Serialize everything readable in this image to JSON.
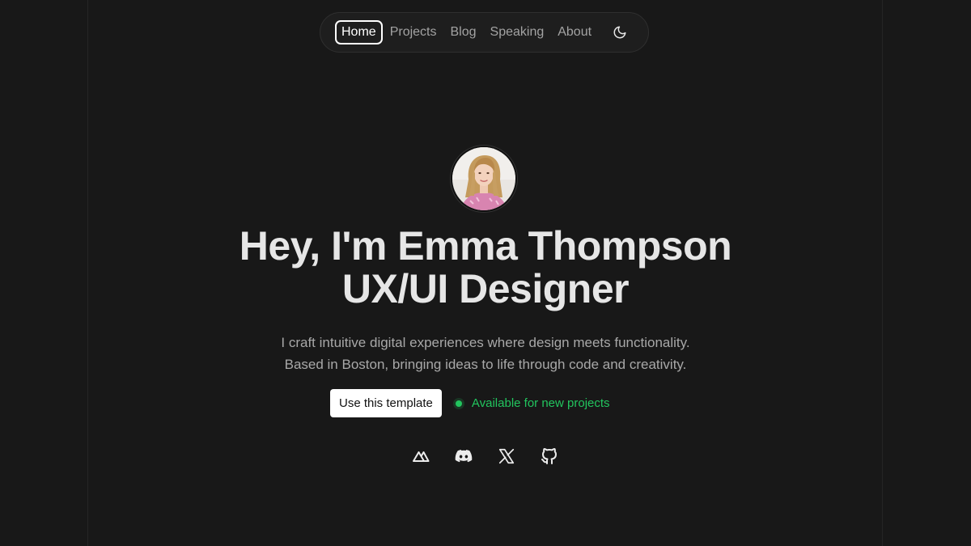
{
  "nav": {
    "items": [
      {
        "label": "Home",
        "active": true
      },
      {
        "label": "Projects",
        "active": false
      },
      {
        "label": "Blog",
        "active": false
      },
      {
        "label": "Speaking",
        "active": false
      },
      {
        "label": "About",
        "active": false
      }
    ],
    "theme_toggle_icon": "moon-icon"
  },
  "hero": {
    "title_line1": "Hey, I'm Emma Thompson",
    "title_line2": "UX/UI Designer",
    "description_line1": "I craft intuitive digital experiences where design meets functionality.",
    "description_line2": "Based in Boston, bringing ideas to life through code and creativity.",
    "cta_label": "Use this template",
    "status_text": "Available for new projects",
    "status_color": "#22c55e"
  },
  "social": [
    {
      "icon": "nuxt-icon"
    },
    {
      "icon": "discord-icon"
    },
    {
      "icon": "x-icon"
    },
    {
      "icon": "github-icon"
    }
  ],
  "colors": {
    "background": "#181818",
    "text": "#e6e6e6",
    "muted": "#a8a8a8",
    "accent": "#22c55e"
  }
}
